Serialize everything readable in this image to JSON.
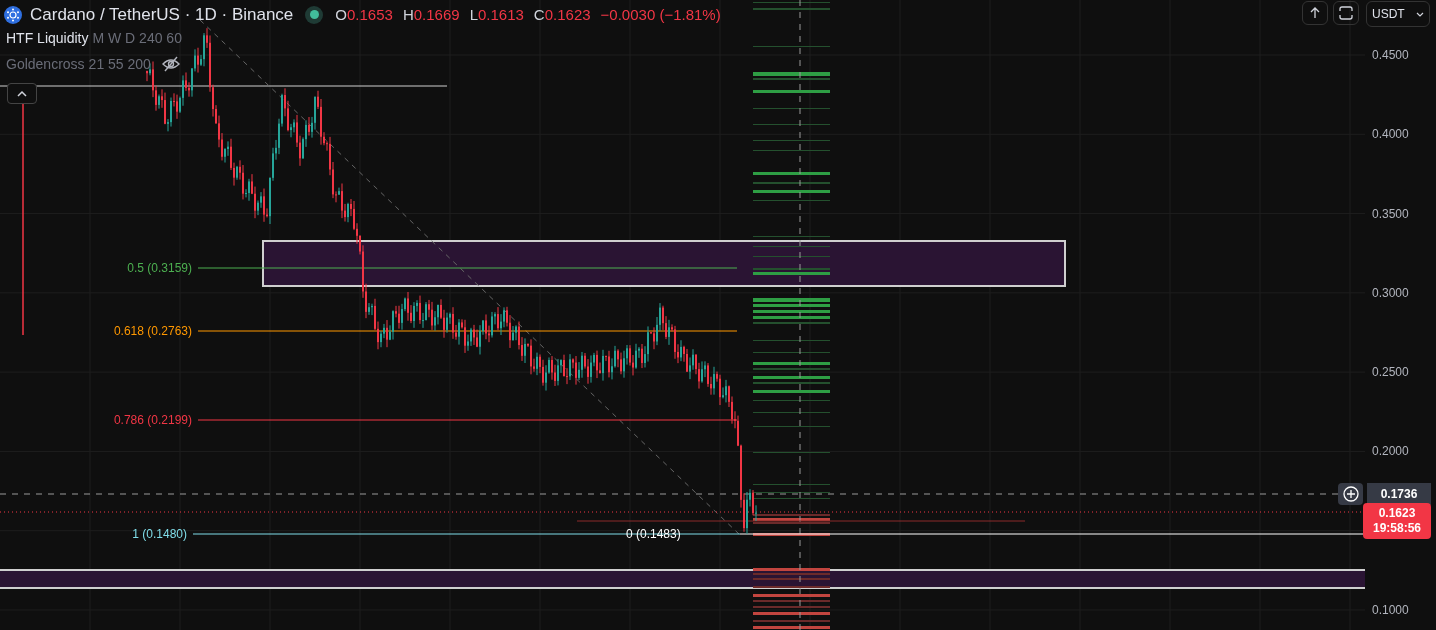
{
  "header": {
    "symbol": "Cardano / TetherUS · 1D · Binance",
    "market_open": true,
    "ohlc": [
      {
        "label": "O",
        "value": "0.1653"
      },
      {
        "label": "H",
        "value": "0.1669"
      },
      {
        "label": "L",
        "value": "0.1613"
      },
      {
        "label": "C",
        "value": "0.1623"
      }
    ],
    "change": "−0.0030 (−1.81%)"
  },
  "indicators": [
    {
      "name": "HTF Liquidity",
      "params": "M W D 240 60",
      "hidden": false
    },
    {
      "name": "Goldencross",
      "params": "21 55 200",
      "hidden": true
    }
  ],
  "currency": "USDT",
  "price_axis": {
    "ticks": [
      "0.4500",
      "0.4000",
      "0.3500",
      "0.3000",
      "0.2500",
      "0.2000",
      "0.1000"
    ]
  },
  "crosshair_price": "0.1736",
  "last_price": {
    "price": "0.1623",
    "countdown": "19:58:56"
  },
  "fib_levels": [
    {
      "label": "0.5 (0.3159)",
      "color": "#4caf50"
    },
    {
      "label": "0.618 (0.2763)",
      "color": "#ff9800"
    },
    {
      "label": "0.786 (0.2199)",
      "color": "#f23645"
    },
    {
      "label": "1 (0.1480)",
      "color": "#80deea"
    }
  ],
  "fib_zero_label": "0 (0.1483)"
}
